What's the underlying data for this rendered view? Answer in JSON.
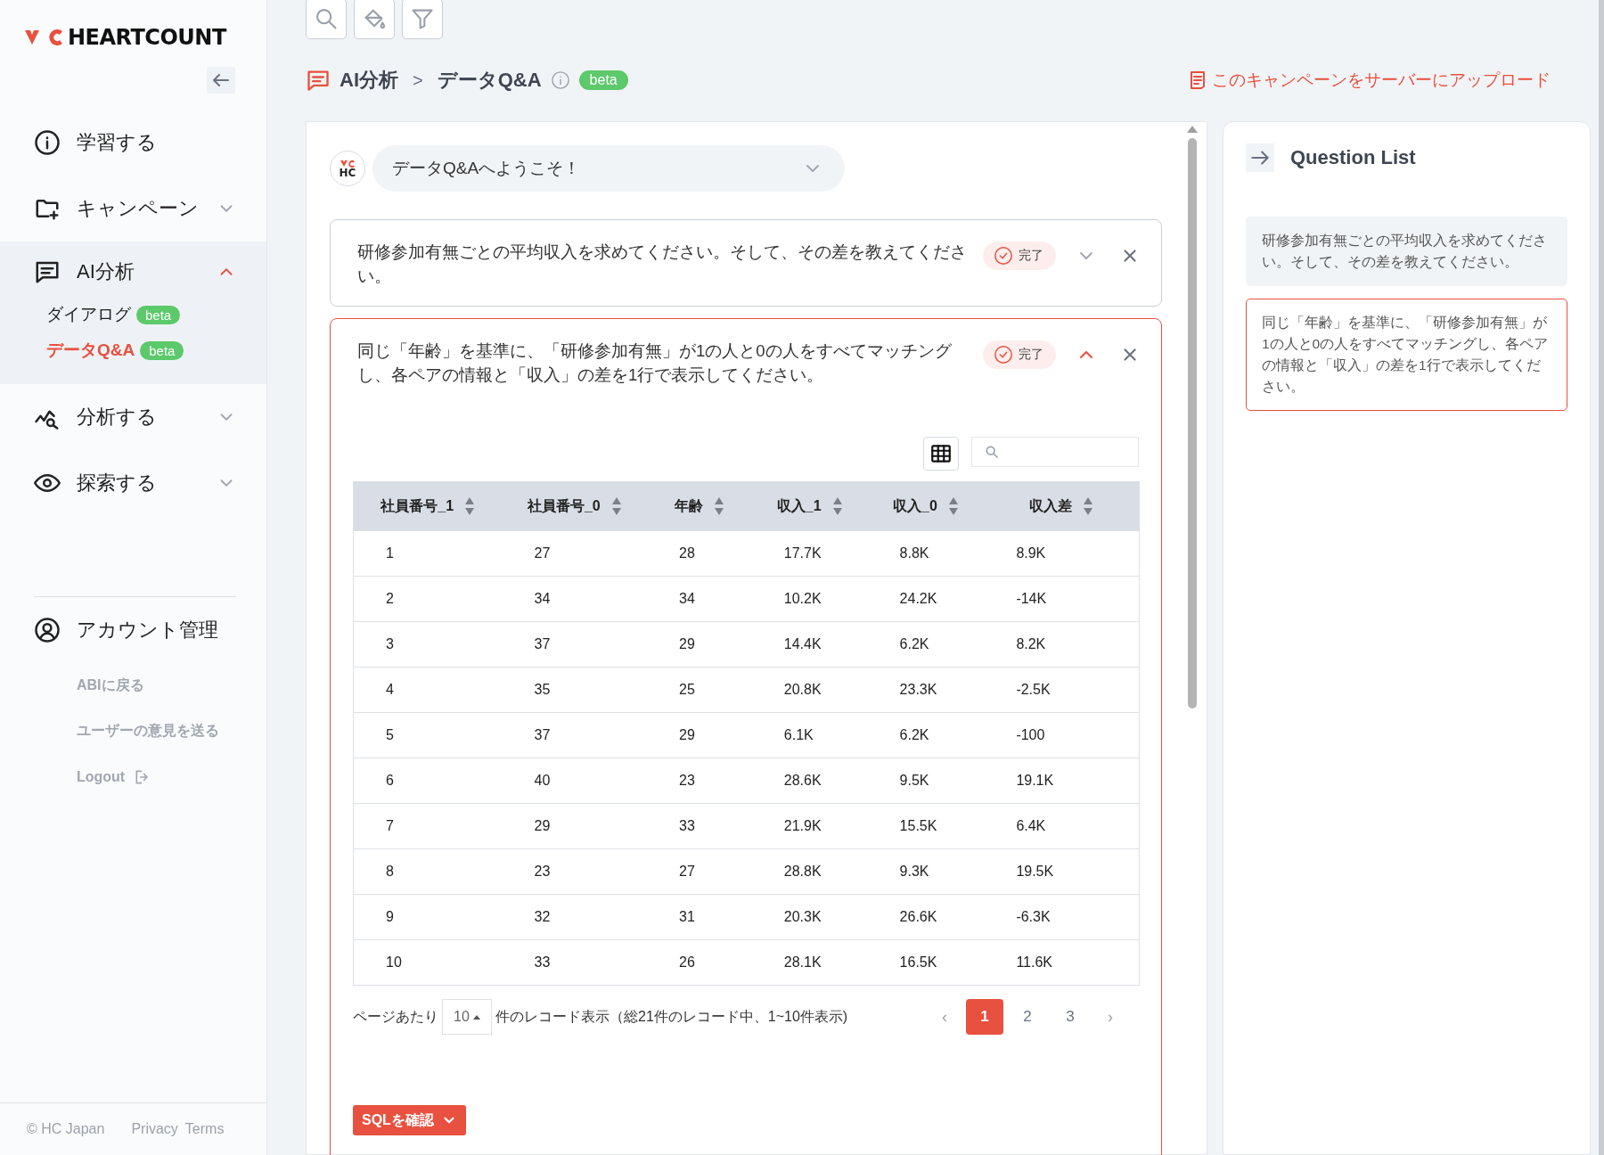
{
  "sidebar": {
    "logo": "HEARTCOUNT",
    "nav": [
      {
        "kind": "link",
        "label": "学習する"
      },
      {
        "kind": "group",
        "label": "キャンペーン",
        "expanded": false,
        "selected": false
      },
      {
        "kind": "group",
        "label": "AI分析",
        "expanded": true,
        "selected": true,
        "children": [
          {
            "label": "ダイアログ",
            "badge": "beta",
            "selected": false
          },
          {
            "label": "データQ&A",
            "badge": "beta",
            "selected": true
          }
        ]
      },
      {
        "kind": "group",
        "label": "分析する",
        "expanded": false,
        "selected": false
      },
      {
        "kind": "group",
        "label": "探索する",
        "expanded": false,
        "selected": false
      }
    ],
    "account": "アカウント管理",
    "links": [
      "ABIに戻る",
      "ユーザーの意見を送る",
      "Logout"
    ],
    "footer": {
      "copyright": "© HC Japan",
      "links": [
        "Privacy",
        "Terms"
      ]
    }
  },
  "header": {
    "breadcrumb": [
      "AI分析",
      "データQ&A"
    ],
    "separator": ">",
    "badge": "beta",
    "upload": "このキャンペーンをサーバーにアップロード"
  },
  "chat": {
    "avatar": "HC",
    "welcome": {
      "text": "データQ&Aへようこそ！",
      "expanded": false
    },
    "questions": [
      {
        "text": "研修参加有無ごとの平均収入を求めてください。そして、その差を教えてください。",
        "status": "完了",
        "expanded": false
      },
      {
        "text": "同じ「年齢」を基準に、「研修参加有無」が1の人と0の人をすべてマッチングし、各ペアの情報と「収入」の差を1行で表示してください。",
        "status": "完了",
        "expanded": true,
        "result": {
          "columns": [
            "社員番号_1",
            "社員番号_0",
            "年齢",
            "収入_1",
            "収入_0",
            "収入差"
          ],
          "rows": [
            [
              "1",
              "27",
              "28",
              "17.7K",
              "8.8K",
              "8.9K"
            ],
            [
              "2",
              "34",
              "34",
              "10.2K",
              "24.2K",
              "-14K"
            ],
            [
              "3",
              "37",
              "29",
              "14.4K",
              "6.2K",
              "8.2K"
            ],
            [
              "4",
              "35",
              "25",
              "20.8K",
              "23.3K",
              "-2.5K"
            ],
            [
              "5",
              "37",
              "29",
              "6.1K",
              "6.2K",
              "-100"
            ],
            [
              "6",
              "40",
              "23",
              "28.6K",
              "9.5K",
              "19.1K"
            ],
            [
              "7",
              "29",
              "33",
              "21.9K",
              "15.5K",
              "6.4K"
            ],
            [
              "8",
              "23",
              "27",
              "28.8K",
              "9.3K",
              "19.5K"
            ],
            [
              "9",
              "32",
              "31",
              "20.3K",
              "26.6K",
              "-6.3K"
            ],
            [
              "10",
              "33",
              "26",
              "28.1K",
              "16.5K",
              "11.6K"
            ]
          ],
          "per_page_label": "ページあたり",
          "per_page": "10",
          "summary": "件のレコード表示（総21件のレコード中、1~10件表示)",
          "prev": "‹",
          "next": "›",
          "pages": [
            {
              "label": "1",
              "selected": true
            },
            {
              "label": "2",
              "selected": false
            },
            {
              "label": "3",
              "selected": false
            }
          ],
          "sql_button": "SQLを確認"
        }
      }
    ]
  },
  "question_list": {
    "title": "Question List",
    "items": [
      {
        "text": "研修参加有無ごとの平均収入を求めてください。そして、その差を教えてください。",
        "selected": false
      },
      {
        "text": "同じ「年齢」を基準に、「研修参加有無」が1の人と0の人をすべてマッチングし、各ペアの情報と「収入」の差を1行で表示してください。",
        "selected": true
      }
    ]
  }
}
